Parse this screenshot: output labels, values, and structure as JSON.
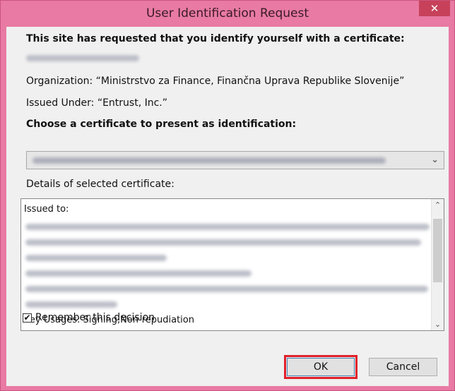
{
  "window": {
    "title": "User Identification Request",
    "close_glyph": "✕"
  },
  "request": {
    "heading": "This site has requested that you identify yourself with a certificate:",
    "organization": "Organization: “Ministrstvo za Finance, Finančna Uprava Republike Slovenije”",
    "issued_under": "Issued Under: “Entrust, Inc.”"
  },
  "certificate": {
    "choose_label": "Choose a certificate to present as identification:",
    "details_label": "Details of selected certificate:",
    "issued_to_label": "Issued to:",
    "key_usages": "Key Usages: Signing,Non-repudiation"
  },
  "remember": {
    "label": "Remember this decision",
    "checked": true,
    "check_glyph": "✔"
  },
  "buttons": {
    "ok": "OK",
    "cancel": "Cancel"
  },
  "icons": {
    "close": "close-icon",
    "dropdown": "chevron-down-icon",
    "scroll_up": "chevron-up-icon",
    "scroll_down": "chevron-down-icon"
  },
  "colors": {
    "title_bar": "#e87aa3",
    "close_button": "#c7415a",
    "highlight": "#e0202a"
  }
}
